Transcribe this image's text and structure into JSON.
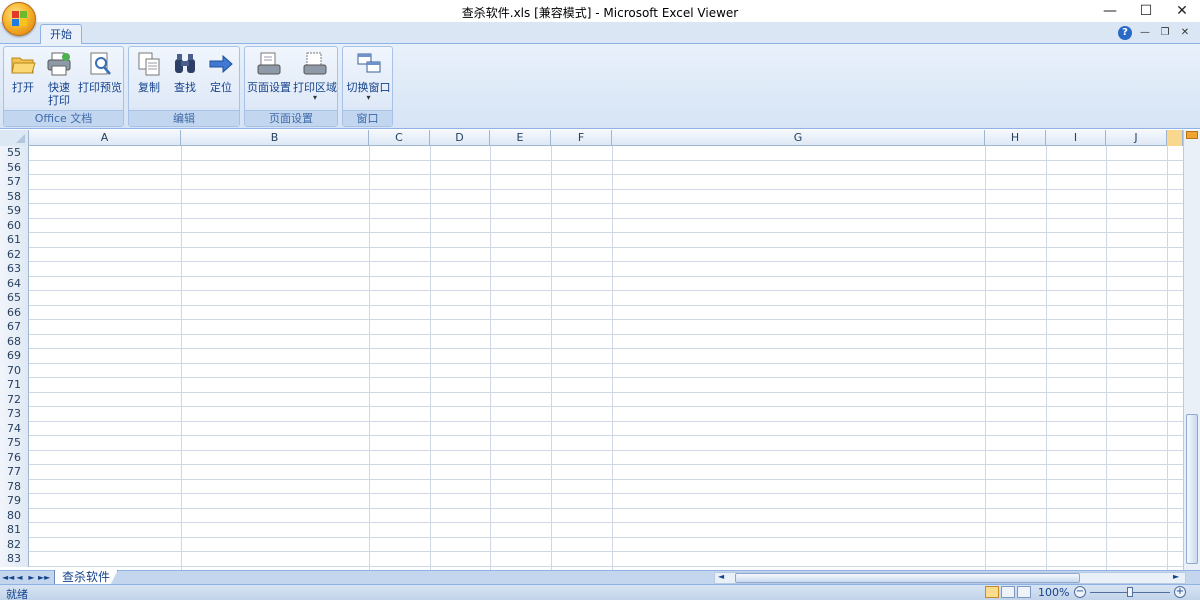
{
  "window": {
    "title": "查杀软件.xls  [兼容模式] - Microsoft Excel Viewer",
    "minimize": "—",
    "maximize": "☐",
    "close": "✕"
  },
  "ribbon": {
    "tabs": [
      {
        "label": "开始",
        "active": true
      }
    ],
    "groups": [
      {
        "label": "Office 文档",
        "buttons": [
          {
            "label": "打开"
          },
          {
            "label": "快速",
            "label2": "打印"
          },
          {
            "label": "打印预览"
          }
        ]
      },
      {
        "label": "编辑",
        "buttons": [
          {
            "label": "复制"
          },
          {
            "label": "查找"
          },
          {
            "label": "定位"
          }
        ]
      },
      {
        "label": "页面设置",
        "buttons": [
          {
            "label": "页面设置"
          },
          {
            "label": "打印区域"
          }
        ]
      },
      {
        "label": "窗口",
        "buttons": [
          {
            "label": "切换窗口"
          }
        ]
      }
    ],
    "dropdown_arrow": "▾",
    "help": "?",
    "mini_min": "—",
    "mini_restore": "❐",
    "mini_close": "✕"
  },
  "sheet": {
    "columns": [
      "A",
      "B",
      "C",
      "D",
      "E",
      "F",
      "G",
      "H",
      "I",
      "J"
    ],
    "rows": [
      "55",
      "56",
      "57",
      "58",
      "59",
      "60",
      "61",
      "62",
      "63",
      "64",
      "65",
      "66",
      "67",
      "68",
      "69",
      "70",
      "71",
      "72",
      "73",
      "74",
      "75",
      "76",
      "77",
      "78",
      "79",
      "80",
      "81",
      "82",
      "83"
    ],
    "tab_name": "查杀软件",
    "nav": [
      "◄◄",
      "◄",
      "►",
      "►►"
    ]
  },
  "status": {
    "ready": "就绪",
    "zoom": "100%",
    "zoom_out": "−",
    "zoom_in": "+",
    "zoom_level_percent": 100
  },
  "colors": {
    "accent": "#f7b52c",
    "ribbon": "#dbe6f4",
    "gridline": "#d0d7e5"
  }
}
